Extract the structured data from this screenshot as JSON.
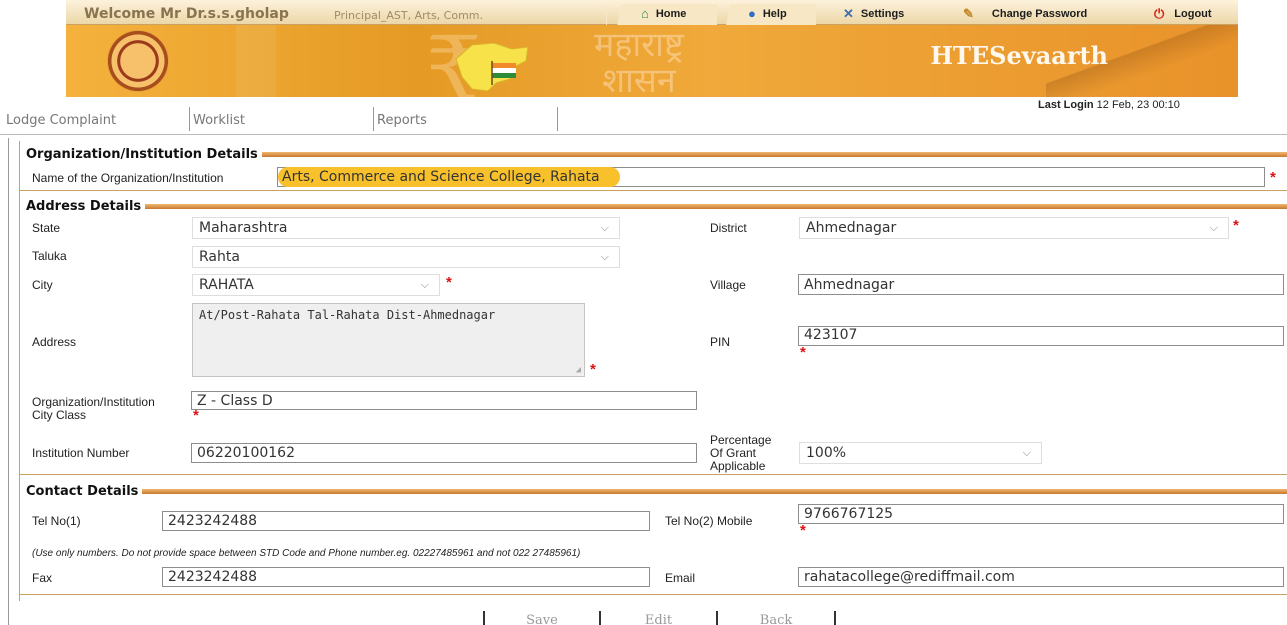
{
  "header": {
    "welcome": "Welcome Mr Dr.s.s.gholap",
    "role": "Principal_AST, Arts, Comm.",
    "links": {
      "home": "Home",
      "help": "Help",
      "settings": "Settings",
      "change_password": "Change Password",
      "logout": "Logout"
    },
    "app_title": "HTESevaarth",
    "marathi_line1": "महाराष्ट्र",
    "marathi_line2": "शासन",
    "last_login_label": "Last Login",
    "last_login_value": "12 Feb, 23 00:10"
  },
  "nav": {
    "lodge": "Lodge Complaint",
    "worklist": "Worklist",
    "reports": "Reports"
  },
  "org": {
    "section": "Organization/Institution Details",
    "name_label": "Name of the Organization/Institution",
    "name_value": "Arts, Commerce and Science College, Rahata"
  },
  "address": {
    "section": "Address Details",
    "state_label": "State",
    "state_value": "Maharashtra",
    "district_label": "District",
    "district_value": "Ahmednagar",
    "taluka_label": "Taluka",
    "taluka_value": "Rahta",
    "city_label": "City",
    "city_value": "RAHATA",
    "village_label": "Village",
    "village_value": "Ahmednagar",
    "address_label": "Address",
    "address_value": "At/Post-Rahata Tal-Rahata Dist-Ahmednagar",
    "pin_label": "PIN",
    "pin_value": "423107",
    "city_class_label_1": "Organization/Institution",
    "city_class_label_2": "City Class",
    "city_class_value": "Z - Class D",
    "inst_number_label": "Institution Number",
    "inst_number_value": "06220100162",
    "grant_label_1": "Percentage",
    "grant_label_2": "Of Grant",
    "grant_label_3": "Applicable",
    "grant_value": "100%"
  },
  "contact": {
    "section": "Contact Details",
    "tel1_label": "Tel No(1)",
    "tel1_value": "2423242488",
    "tel2_label": "Tel No(2) Mobile",
    "tel2_value": "9766767125",
    "hint": "(Use only numbers. Do not provide space between STD Code and Phone number.eg. 02227485961 and not 022 27485961)",
    "fax_label": "Fax",
    "fax_value": "2423242488",
    "email_label": "Email",
    "email_value": "rahatacollege@rediffmail.com"
  },
  "buttons": {
    "save": "Save",
    "edit": "Edit",
    "back": "Back"
  },
  "colors": {
    "accent_orange": "#e59a25",
    "section_rule": "#c9782f",
    "required": "#dd1111",
    "highlight": "#f8c12b"
  }
}
